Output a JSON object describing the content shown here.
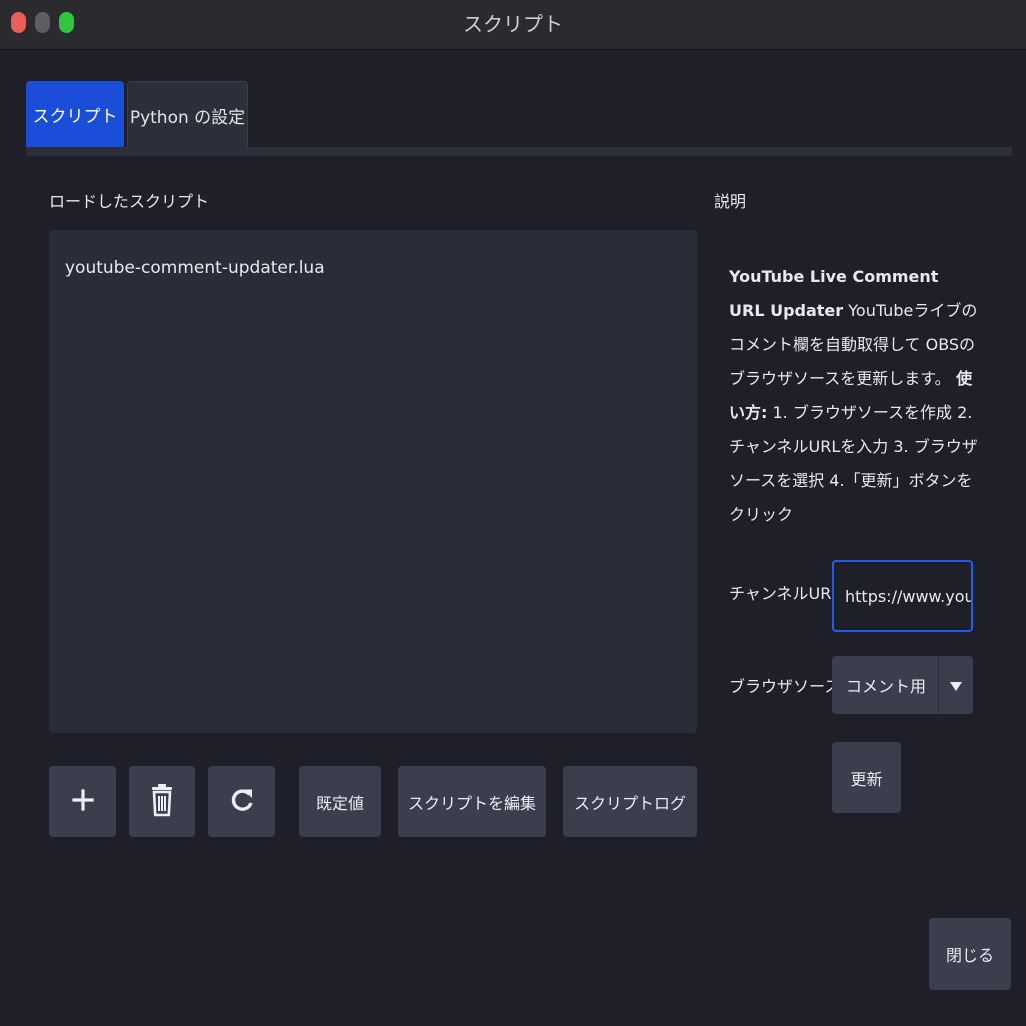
{
  "window": {
    "title": "スクリプト"
  },
  "tabs": [
    {
      "label": "スクリプト"
    },
    {
      "label": "Python の設定"
    }
  ],
  "loaded_scripts": {
    "label": "ロードしたスクリプト",
    "items": [
      "youtube-comment-updater.lua"
    ]
  },
  "toolbar": {
    "add_icon": "plus-icon",
    "delete_icon": "trash-icon",
    "reload_icon": "reload-icon",
    "defaults_label": "既定値",
    "edit_label": "スクリプトを編集",
    "log_label": "スクリプトログ"
  },
  "description": {
    "label": "説明",
    "title": "YouTube Live Comment URL Updater",
    "body": " YouTubeライブのコメント欄を自動取得して OBSのブラウザソースを更新します。",
    "usage_label": " 使い方:",
    "usage_steps": " 1. ブラウザソースを作成 2. チャンネルURLを入力 3. ブラウザソースを選択 4.「更新」ボタンをクリック"
  },
  "settings": {
    "channel_url_label": "チャンネルURL",
    "channel_url_value": "https://www.youtu",
    "browser_source_label": "ブラウザソース",
    "browser_source_value": "コメント用",
    "dropdown_icon": "triangle-down-icon",
    "update_label": "更新"
  },
  "footer": {
    "close_label": "閉じる"
  },
  "colors": {
    "accent": "#1b4ed8",
    "focus_border": "#1f5ee6",
    "background": "#1e1f28",
    "panel": "#2a2c38",
    "button": "#3b3e4c"
  }
}
